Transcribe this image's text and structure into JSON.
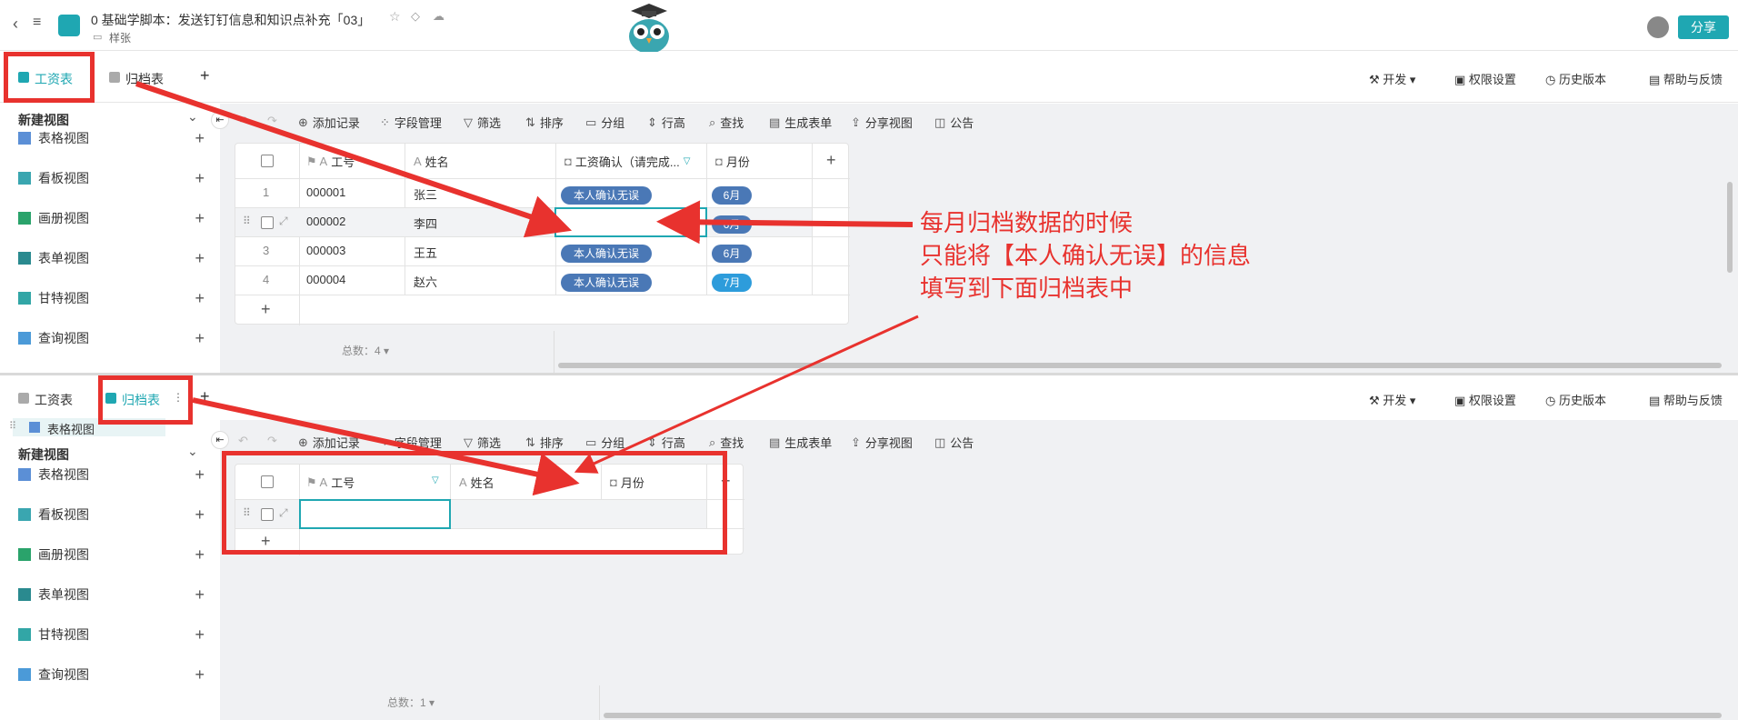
{
  "header": {
    "doc_title": "0 基础学脚本：发送钉钉信息和知识点补充「03」",
    "folder": "样张",
    "share_label": "分享"
  },
  "top": {
    "tabs": [
      "工资表",
      "归档表"
    ],
    "right_tools": [
      "开发",
      "权限设置",
      "历史版本",
      "帮助与反馈"
    ],
    "toolbar": [
      "添加记录",
      "字段管理",
      "筛选",
      "排序",
      "分组",
      "行高",
      "查找",
      "生成表单",
      "分享视图",
      "公告"
    ],
    "sidebar_title": "新建视图",
    "views": [
      "表格视图",
      "看板视图",
      "画册视图",
      "表单视图",
      "甘特视图",
      "查询视图"
    ],
    "columns": [
      "工号",
      "姓名",
      "工资确认（请完成...",
      "月份"
    ],
    "rows": [
      {
        "n": "1",
        "id": "000001",
        "name": "张三",
        "confirm": "本人确认无误",
        "month": "6月"
      },
      {
        "n": "",
        "id": "000002",
        "name": "李四",
        "confirm": "",
        "month": "6月"
      },
      {
        "n": "3",
        "id": "000003",
        "name": "王五",
        "confirm": "本人确认无误",
        "month": "6月"
      },
      {
        "n": "4",
        "id": "000004",
        "name": "赵六",
        "confirm": "本人确认无误",
        "month": "7月"
      }
    ],
    "total": "总数：4"
  },
  "bottom": {
    "tabs": [
      "工资表",
      "归档表"
    ],
    "current_view": "表格视图",
    "right_tools": [
      "开发",
      "权限设置",
      "历史版本",
      "帮助与反馈"
    ],
    "toolbar": [
      "添加记录",
      "字段管理",
      "筛选",
      "排序",
      "分组",
      "行高",
      "查找",
      "生成表单",
      "分享视图",
      "公告"
    ],
    "sidebar_title": "新建视图",
    "views": [
      "表格视图",
      "看板视图",
      "画册视图",
      "表单视图",
      "甘特视图",
      "查询视图"
    ],
    "columns": [
      "工号",
      "姓名",
      "月份"
    ],
    "total": "总数：1"
  },
  "annotation": {
    "lines": [
      "每月归档数据的时候",
      "只能将【本人确认无误】的信息",
      "填写到下面归档表中"
    ]
  },
  "colors": {
    "accent": "#1fa7b2",
    "tag": "#4a78b6",
    "tag_light": "#2d9cdb",
    "annotation": "#e8322e"
  }
}
